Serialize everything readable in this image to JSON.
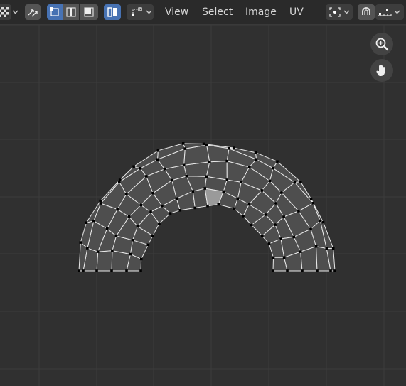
{
  "header": {
    "menus": [
      "View",
      "Select",
      "Image",
      "UV"
    ]
  },
  "icons": {
    "checker": "checker-pattern-icon",
    "sync": "sticky-selection-icon",
    "vertex_select": "vertex-select-icon",
    "edge_select": "edge-select-icon",
    "face_select": "face-select-icon",
    "island_select": "island-select-icon",
    "selection_mode": "selection-mode-icon",
    "pivot": "pivot-point-icon",
    "snap": "snap-magnet-icon",
    "snap_increment": "snap-increment-icon",
    "zoom": "zoom-in-icon",
    "pan": "hand-pan-icon"
  },
  "colors": {
    "background": "#303030",
    "header": "#2a2a2a",
    "accent": "#4772b3",
    "face_fill": "#4e4e4e",
    "selected_face": "#9a9a9a",
    "edge": "#e8e8e8",
    "vertex": "#000000",
    "grid": "#3c3c3c"
  },
  "uv_mesh": {
    "rings": 5,
    "segments": 16,
    "selected_face": [
      5,
      4
    ]
  }
}
